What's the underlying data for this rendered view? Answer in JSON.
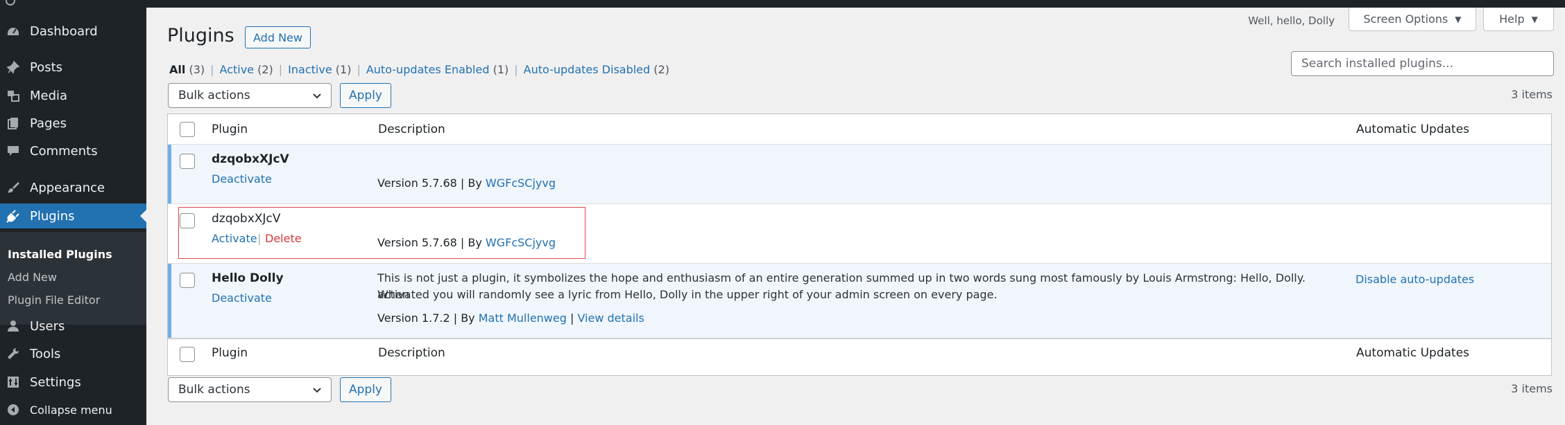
{
  "sidebar": {
    "items": [
      {
        "key": "dashboard",
        "label": "Dashboard",
        "icon": "dashboard-icon"
      },
      {
        "key": "posts",
        "label": "Posts",
        "icon": "pin-icon"
      },
      {
        "key": "media",
        "label": "Media",
        "icon": "media-icon"
      },
      {
        "key": "pages",
        "label": "Pages",
        "icon": "page-icon"
      },
      {
        "key": "comments",
        "label": "Comments",
        "icon": "comment-icon"
      },
      {
        "key": "appearance",
        "label": "Appearance",
        "icon": "brush-icon"
      },
      {
        "key": "plugins",
        "label": "Plugins",
        "icon": "plug-icon"
      },
      {
        "key": "users",
        "label": "Users",
        "icon": "user-icon"
      },
      {
        "key": "tools",
        "label": "Tools",
        "icon": "wrench-icon"
      },
      {
        "key": "settings",
        "label": "Settings",
        "icon": "settings-icon"
      },
      {
        "key": "collapse",
        "label": "Collapse menu",
        "icon": "collapse-icon"
      }
    ],
    "submenu": [
      "Installed Plugins",
      "Add New",
      "Plugin File Editor"
    ]
  },
  "header": {
    "greeting": "Well, hello, Dolly",
    "screen_options": "Screen Options",
    "help": "Help"
  },
  "page": {
    "title": "Plugins",
    "add_new": "Add New"
  },
  "filters": [
    {
      "label": "All",
      "count": "(3)"
    },
    {
      "label": "Active",
      "count": "(2)"
    },
    {
      "label": "Inactive",
      "count": "(1)"
    },
    {
      "label": "Auto-updates Enabled",
      "count": "(1)"
    },
    {
      "label": "Auto-updates Disabled",
      "count": "(2)"
    }
  ],
  "search": {
    "placeholder": "Search installed plugins..."
  },
  "bulk": {
    "label": "Bulk actions",
    "apply": "Apply",
    "items": "3 items"
  },
  "table": {
    "columns": [
      "Plugin",
      "Description",
      "Automatic Updates"
    ],
    "rows": [
      {
        "name": "dzqobxXJcV",
        "action1": "Deactivate",
        "version": "Version 5.7.68 | By ",
        "author": "WGFcSCjyvg"
      },
      {
        "name": "dzqobxXJcV",
        "action1": "Activate",
        "action_sep": "|",
        "action2": "Delete",
        "version": "Version 5.7.68 | By ",
        "author": "WGFcSCjyvg"
      },
      {
        "name": "Hello Dolly",
        "action1": "Deactivate",
        "description_1": "This is not just a plugin, it symbolizes the hope and enthusiasm of an entire generation summed up in two words sung most famously by Louis Armstrong: Hello, Dolly. When",
        "description_2": "activated you will randomly see a lyric from Hello, Dolly in the upper right of your admin screen on every page.",
        "version": "Version 1.7.2 | By ",
        "author": "Matt Mullenweg",
        "sep": " | ",
        "details": "View details",
        "auto_update": "Disable auto-updates"
      }
    ]
  }
}
